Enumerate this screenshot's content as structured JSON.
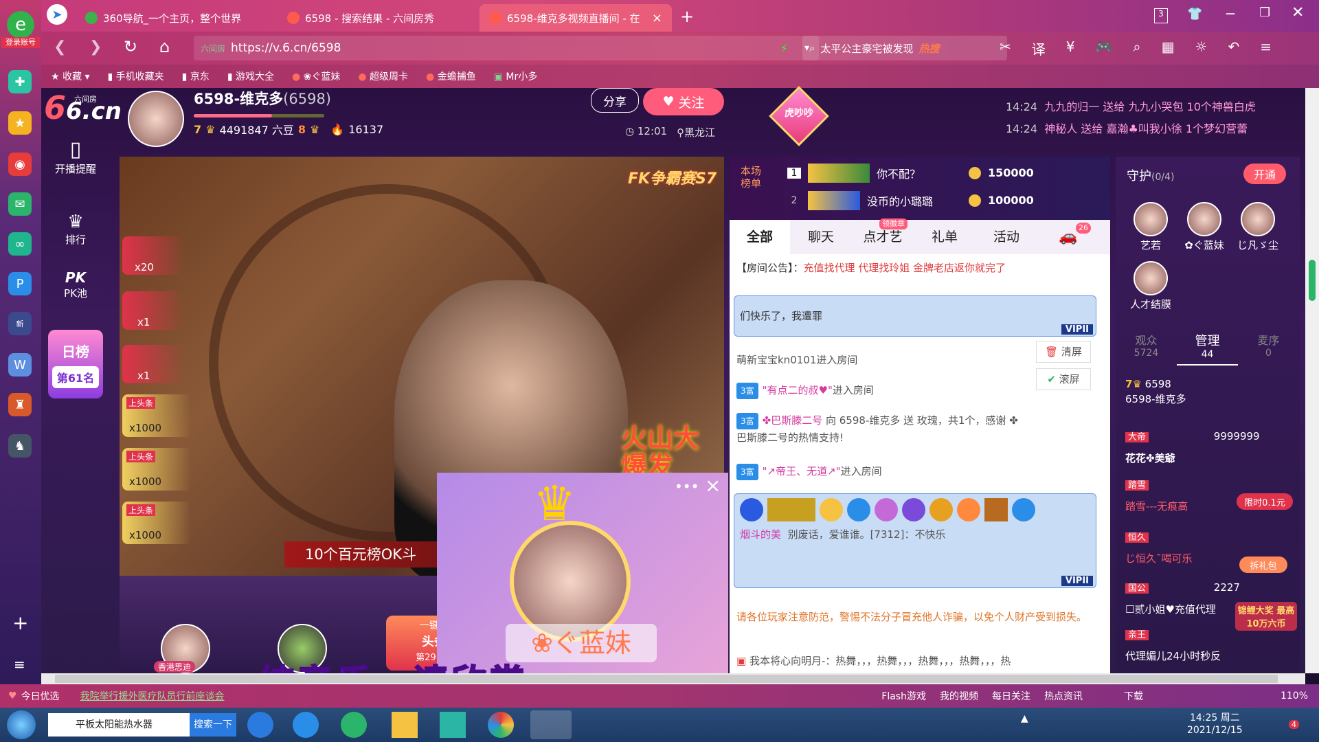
{
  "browser": {
    "tabs": [
      {
        "label": "360导航_一个主页，整个世界"
      },
      {
        "label": "6598 - 搜索结果 - 六间房秀"
      },
      {
        "label": "6598-维克多视频直播间 - 在"
      }
    ],
    "tab_count": "3",
    "url_prefix": "六间房",
    "url": "https://v.6.cn/6598",
    "search_text": "太平公主豪宅被发现",
    "search_hot": "热搜",
    "login_label": "登录账号",
    "bookmarks": [
      "收藏",
      "手机收藏夹",
      "京东",
      "游戏大全",
      "❀ぐ蓝妹",
      "超级周卡",
      "金蟾捕鱼",
      "Mr小多"
    ]
  },
  "room": {
    "logo_sub": "六间房",
    "logo_main": "6.cn",
    "anchor_name": "6598-维克多",
    "anchor_id": "(6598)",
    "level_left": "7",
    "beans": "4491847 六豆",
    "level_right": "8",
    "fire_count": "16137",
    "share_label": "分享",
    "follow_label": "关注",
    "time": "12:01",
    "location": "黑龙江",
    "heart_badge": "虎吵吵",
    "notices": [
      {
        "time": "14:24",
        "text": "九九的归一 送给 九九小哭包 10个神兽白虎"
      },
      {
        "time": "14:24",
        "text": "神秘人 送给 嘉瀚♣叫我小徐 1个梦幻营蕾"
      }
    ]
  },
  "left_nav": [
    {
      "label": "开播提醒"
    },
    {
      "label": "排行"
    },
    {
      "label": "PK池"
    }
  ],
  "day_rank": {
    "title": "日榜",
    "rank": "第61名"
  },
  "video": {
    "banner_top": "FK争霸赛S7",
    "flame_text": "火山大爆发",
    "ticker": "10个百元榜OK斗",
    "bottom_text": "纯音乐，请欣赏",
    "gifts": [
      {
        "count": "x20"
      },
      {
        "count": "x1"
      },
      {
        "count": "x1"
      },
      {
        "count": "x1000",
        "tag": "上头条"
      },
      {
        "count": "x1000",
        "tag": "上头条"
      },
      {
        "count": "x1000",
        "tag": "上头条"
      }
    ],
    "bottom_users": [
      {
        "name": "香港思迪"
      }
    ],
    "headline_btn": "一键榜",
    "headline_sub": "头条",
    "headline_rank": "第29+名"
  },
  "popup": {
    "name": "❀ぐ蓝妹",
    "menu": "•••",
    "close": "×"
  },
  "scene_rank": {
    "title": "本场榜单",
    "rows": [
      {
        "rank": "1",
        "name": "你不配？",
        "coins": "150000"
      },
      {
        "rank": "2",
        "name": "没币的小璐璐",
        "coins": "100000"
      }
    ]
  },
  "chat_tabs": [
    {
      "label": "全部"
    },
    {
      "label": "聊天"
    },
    {
      "label": "点才艺",
      "badge": "领徽章"
    },
    {
      "label": "礼单"
    },
    {
      "label": "活动"
    },
    {
      "label": "",
      "badge": "26"
    }
  ],
  "chat": {
    "announcement_prefix": "【房间公告】：",
    "announcement": "充值找代理 代理找玲姐 金牌老店返你就完了",
    "clear_label": "清屏",
    "scroll_label": "滚屏",
    "messages": [
      {
        "text": "们快乐了，我遭罪",
        "vip": "VIPII"
      },
      {
        "text": "萌新宝宝kn0101进入房间"
      },
      {
        "badge": "3富",
        "user": "\"有点二的叔♥\"",
        "text": "进入房间"
      },
      {
        "badge": "3富",
        "user": "✤巴斯滕二号",
        "text": "向 6598-维克多 送  玫瑰，共1个，感谢 ✤巴斯滕二号的热情支持!"
      },
      {
        "badge": "3富",
        "user": "\"↗帝王、无道↗\"",
        "text": "进入房间"
      },
      {
        "user": "烟斗的美",
        "text": "别废话，爱谁谁。[7312]：不快乐",
        "vip": "VIPII"
      }
    ],
    "warning": "请各位玩家注意防范，警惕不法分子冒充他人诈骗，以免个人财产受到损失。",
    "last_line": "我本将心向明月-：热舞，，，热舞，，，热舞，，，热舞，，，热"
  },
  "guard": {
    "title": "守护",
    "count": "(0/4)",
    "open_label": "开通",
    "members": [
      {
        "name": "艺若"
      },
      {
        "name": "✿ぐ蓝妹"
      },
      {
        "name": "じ凡ゞ尘"
      },
      {
        "name": "人才结膜"
      }
    ],
    "tabs": [
      {
        "label": "观众",
        "value": "5724"
      },
      {
        "label": "管理",
        "value": "44"
      },
      {
        "label": "麦序",
        "value": "0"
      }
    ],
    "users": [
      {
        "level": "7",
        "id": "6598",
        "name": "6598-维克多"
      },
      {
        "tag": "大帝",
        "name": "花花✤美爺",
        "coins": "9999999"
      },
      {
        "tag": "踏雪",
        "name": "踏雪---无痕高",
        "promo": "限时0.1元"
      },
      {
        "tag": "恒久",
        "name": "じ恒久˜喝可乐",
        "promo": "拆礼包"
      },
      {
        "tag": "国公",
        "name": "☐贰小姐♥充值代理",
        "coins": "2227"
      },
      {
        "tag": "亲王",
        "name": "代理媚儿24小时秒反",
        "promo": "锦鲤大奖 最高10万六币"
      }
    ]
  },
  "statusbar": {
    "left": "今日优选",
    "news": "我院举行援外医疗队员行前座谈会",
    "items": [
      "Flash游戏",
      "我的视频",
      "每日关注",
      "热点资讯",
      "下载"
    ],
    "zoom": "110%"
  },
  "taskbar": {
    "app_label": "平板太阳能热水器",
    "search_label": "搜索一下",
    "time": "14:25 周二",
    "date": "2021/12/15",
    "notif": "4"
  },
  "colors": {
    "accent": "#ff4d6a",
    "brand": "#c23a78",
    "vip_blue": "#2a8ee8"
  }
}
